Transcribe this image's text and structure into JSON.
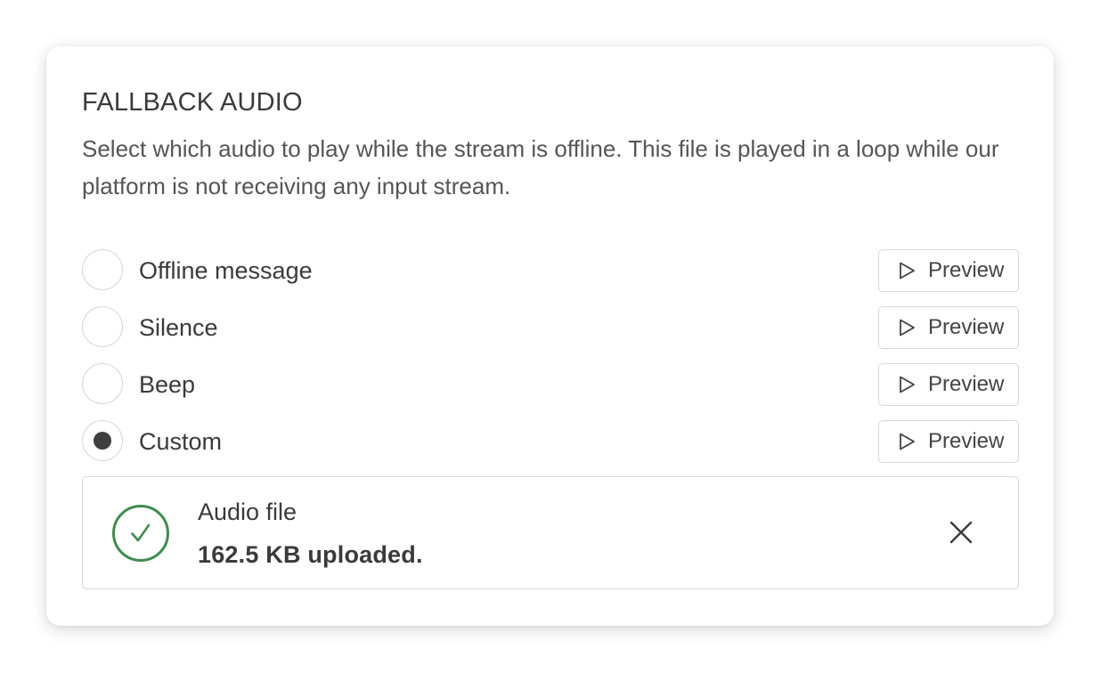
{
  "section": {
    "title": "FALLBACK AUDIO",
    "description": "Select which audio to play while the stream is offline. This file is played in a loop while our platform is not receiving any input stream."
  },
  "options": [
    {
      "label": "Offline message",
      "selected": false,
      "preview_label": "Preview"
    },
    {
      "label": "Silence",
      "selected": false,
      "preview_label": "Preview"
    },
    {
      "label": "Beep",
      "selected": false,
      "preview_label": "Preview"
    },
    {
      "label": "Custom",
      "selected": true,
      "preview_label": "Preview"
    }
  ],
  "upload": {
    "label": "Audio file",
    "status": "162.5 KB uploaded.",
    "status_icon": "check-circle-icon",
    "remove_icon": "close-icon",
    "success_color": "#3e8b4f"
  }
}
